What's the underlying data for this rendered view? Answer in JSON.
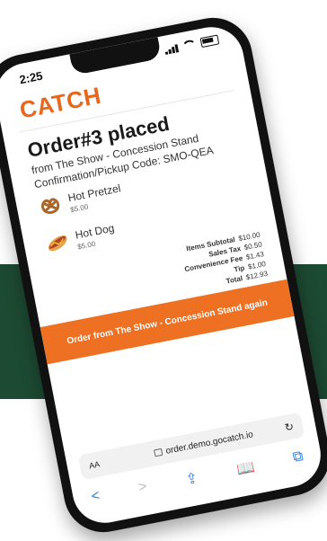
{
  "status": {
    "time": "2:25"
  },
  "brand": {
    "logo": "CATCH"
  },
  "order": {
    "title": "Order#3 placed",
    "from": "from The Show - Concession Stand",
    "code": "Confirmation/Pickup Code: SMO-QEA"
  },
  "items": [
    {
      "name": "Hot Pretzel",
      "price": "$5.00",
      "icon": "pretzel-icon"
    },
    {
      "name": "Hot Dog",
      "price": "$5.00",
      "icon": "hot-dog-icon"
    }
  ],
  "totals": [
    {
      "label": "Items Subtotal",
      "value": "$10.00"
    },
    {
      "label": "Sales Tax",
      "value": "$0.50"
    },
    {
      "label": "Convenience Fee",
      "value": "$1.43"
    },
    {
      "label": "Tip",
      "value": "$1.00"
    },
    {
      "label": "Total",
      "value": "$12.93"
    }
  ],
  "cta": {
    "label": "Order from The Show - Concession Stand again"
  },
  "browser": {
    "aa": "AA",
    "url": "order.demo.gocatch.io",
    "reload": "↻",
    "buttons": [
      "<",
      ">",
      "⇪",
      "📖",
      "⧉"
    ]
  },
  "colors": {
    "band": "#1d4a33",
    "accent": "#ee7022",
    "logo": "#e8671d"
  }
}
